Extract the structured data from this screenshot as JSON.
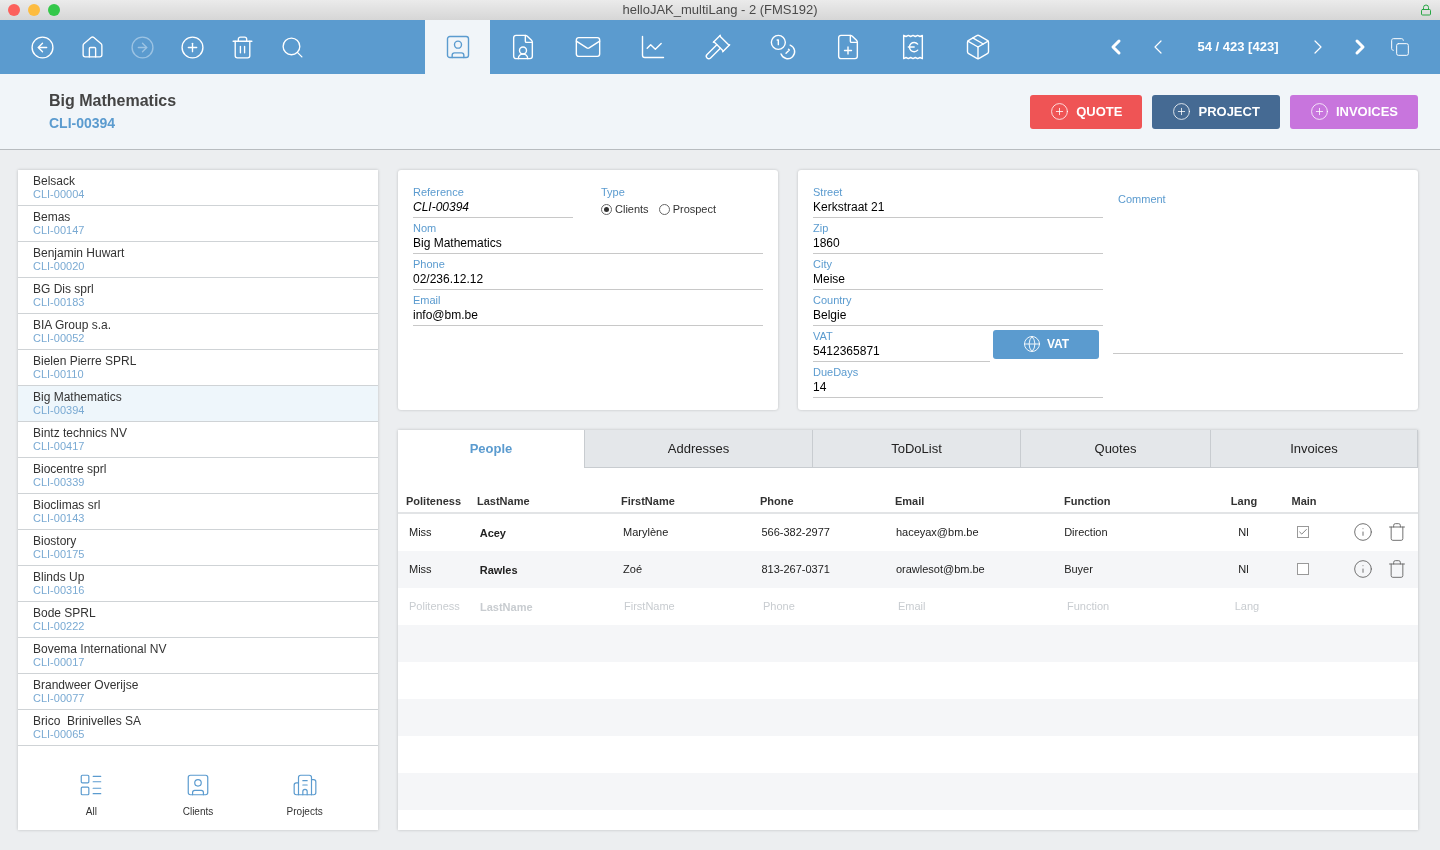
{
  "window": {
    "title": "helloJAK_multiLang - 2 (FMS192)"
  },
  "toolbar": {
    "actions": [
      {
        "disabled": false
      },
      {
        "disabled": false
      },
      {
        "disabled": true
      },
      {
        "disabled": false
      },
      {
        "disabled": false
      },
      {
        "disabled": false
      }
    ],
    "modules": [
      {
        "selected": true
      },
      {
        "selected": false
      },
      {
        "selected": false
      },
      {
        "selected": false
      },
      {
        "selected": false
      },
      {
        "selected": false
      },
      {
        "selected": false
      },
      {
        "selected": false
      },
      {
        "selected": false
      }
    ],
    "record_counter": "54 / 423 [423]"
  },
  "header": {
    "name": "Big Mathematics",
    "code": "CLI-00394",
    "buttons": [
      {
        "label": "QUOTE",
        "color": "#ef5455"
      },
      {
        "label": "PROJECT",
        "color": "#456a93"
      },
      {
        "label": "INVOICES",
        "color": "#c875dd"
      }
    ]
  },
  "client_list": {
    "items": [
      {
        "name": "Belsack",
        "code": "CLI-00004",
        "selected": false
      },
      {
        "name": "Bemas",
        "code": "CLI-00147",
        "selected": false
      },
      {
        "name": "Benjamin Huwart",
        "code": "CLI-00020",
        "selected": false
      },
      {
        "name": "BG Dis sprl",
        "code": "CLI-00183",
        "selected": false
      },
      {
        "name": "BIA Group s.a.",
        "code": "CLI-00052",
        "selected": false
      },
      {
        "name": "Bielen Pierre SPRL",
        "code": "CLI-00110",
        "selected": false
      },
      {
        "name": "Big Mathematics",
        "code": "CLI-00394",
        "selected": true
      },
      {
        "name": "Bintz technics NV",
        "code": "CLI-00417",
        "selected": false
      },
      {
        "name": "Biocentre sprl",
        "code": "CLI-00339",
        "selected": false
      },
      {
        "name": "Bioclimas srl",
        "code": "CLI-00143",
        "selected": false
      },
      {
        "name": "Biostory",
        "code": "CLI-00175",
        "selected": false
      },
      {
        "name": "Blinds Up",
        "code": "CLI-00316",
        "selected": false
      },
      {
        "name": "Bode SPRL",
        "code": "CLI-00222",
        "selected": false
      },
      {
        "name": "Bovema International NV",
        "code": "CLI-00017",
        "selected": false
      },
      {
        "name": "Brandweer Overijse",
        "code": "CLI-00077",
        "selected": false
      },
      {
        "name": "Brico  Brinivelles SA",
        "code": "CLI-00065",
        "selected": false
      }
    ],
    "filters": [
      {
        "label": "All"
      },
      {
        "label": "Clients"
      },
      {
        "label": "Projects"
      }
    ]
  },
  "identity_form": {
    "reference": {
      "label": "Reference",
      "value": "CLI-00394"
    },
    "type": {
      "label": "Type",
      "options": [
        {
          "label": "Clients",
          "selected": true
        },
        {
          "label": "Prospect",
          "selected": false
        }
      ]
    },
    "fields": [
      {
        "label": "Nom",
        "value": "Big Mathematics"
      },
      {
        "label": "Phone",
        "value": "02/236.12.12"
      },
      {
        "label": "Email",
        "value": "info@bm.be"
      }
    ]
  },
  "address_form": {
    "fields": [
      {
        "label": "Street",
        "value": "Kerkstraat 21"
      },
      {
        "label": "Zip",
        "value": "1860"
      },
      {
        "label": "City",
        "value": "Meise"
      },
      {
        "label": "Country",
        "value": "Belgie"
      },
      {
        "label": "VAT",
        "value": "5412365871"
      },
      {
        "label": "DueDays",
        "value": "14"
      }
    ],
    "vat_button": "VAT",
    "comment": {
      "label": "Comment"
    }
  },
  "tabs": [
    {
      "label": "People",
      "selected": true
    },
    {
      "label": "Addresses",
      "selected": false
    },
    {
      "label": "ToDoList",
      "selected": false
    },
    {
      "label": "Quotes",
      "selected": false
    },
    {
      "label": "Invoices",
      "selected": false
    }
  ],
  "people_table": {
    "columns": [
      "Politeness",
      "LastName",
      "FirstName",
      "Phone",
      "Email",
      "Function",
      "Lang",
      "Main"
    ],
    "rows": [
      {
        "politeness": "Miss",
        "last_name": "Acey",
        "first_name": "Marylène",
        "phone": "566-382-2977",
        "email": "haceyax@bm.be",
        "function": "Direction",
        "lang": "Nl",
        "main": true
      },
      {
        "politeness": "Miss",
        "last_name": "Rawles",
        "first_name": "Zoé",
        "phone": "813-267-0371",
        "email": "orawlesot@bm.be",
        "function": "Buyer",
        "lang": "Nl",
        "main": false
      }
    ],
    "new_row": {
      "politeness": "Politeness",
      "last_name": "LastName",
      "first_name": "FirstName",
      "phone": "Phone",
      "email": "Email",
      "function": "Function",
      "lang": "Lang"
    }
  }
}
